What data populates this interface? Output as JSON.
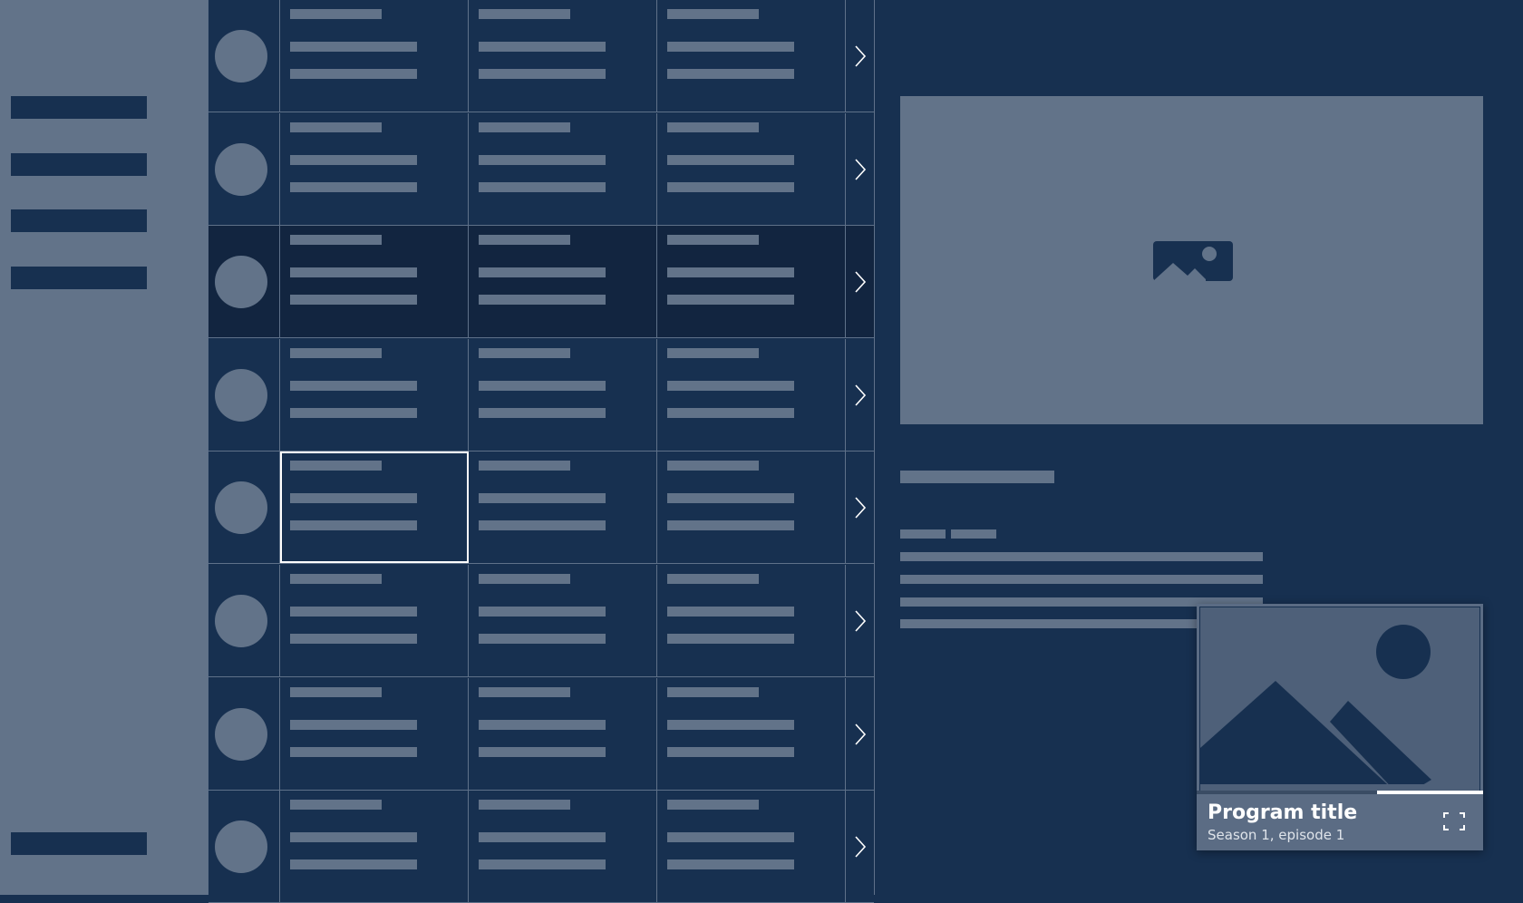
{
  "colors": {
    "background": "#173050",
    "placeholder": "#627389",
    "grid_line": "#5f7189",
    "selected_outline": "#ffffff",
    "mini_player_bg": "#5b6c84"
  },
  "sidebar": {
    "items": [
      "",
      "",
      "",
      ""
    ],
    "footer_item": ""
  },
  "grid": {
    "rows": 8,
    "highlighted_row": 3,
    "selected_row": 5,
    "selected_column": 1,
    "row_action_icon": "chevron-right-icon"
  },
  "detail": {
    "hero_icon": "image-placeholder-icon"
  },
  "mini_player": {
    "title": "Program title",
    "subtitle": "Season 1, episode 1",
    "progress": 0.63,
    "fullscreen_icon": "fullscreen-icon",
    "artwork_icon": "landscape-image-icon"
  }
}
